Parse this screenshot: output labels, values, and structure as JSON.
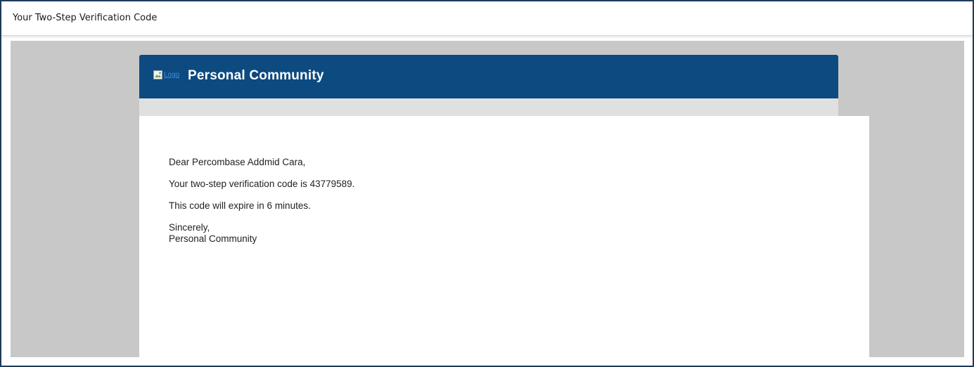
{
  "window": {
    "title": "Your Two-Step Verification Code"
  },
  "email": {
    "header": {
      "logo_alt": "Logo",
      "brand_name": "Personal Community",
      "brand_color": "#0d4a80"
    },
    "body": {
      "greeting": "Dear Percombase Addmid Cara,",
      "code_line": "Your two-step verification code is 43779589.",
      "expiry_line": "This code will expire in 6 minutes.",
      "signoff": "Sincerely,",
      "signature": "Personal Community"
    }
  },
  "icons": {
    "logo": "broken-image-icon"
  }
}
